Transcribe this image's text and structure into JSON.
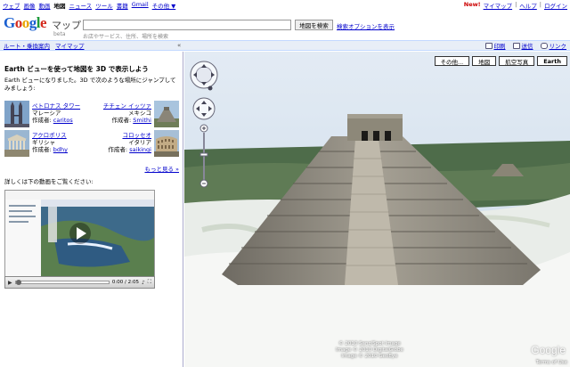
{
  "topnav": {
    "items": [
      {
        "label": "ウェブ",
        "current": false
      },
      {
        "label": "画像",
        "current": false
      },
      {
        "label": "動画",
        "current": false
      },
      {
        "label": "地図",
        "current": true
      },
      {
        "label": "ニュース",
        "current": false
      },
      {
        "label": "ツール",
        "current": false
      },
      {
        "label": "書籍",
        "current": false
      },
      {
        "label": "Gmail",
        "current": false
      },
      {
        "label": "その他 ▼",
        "current": false
      }
    ],
    "new_label": "New!",
    "mymaps": "マイマップ",
    "help": "ヘルプ",
    "login": "ログイン"
  },
  "header": {
    "product": "マップ",
    "beta": "beta",
    "search_value": "",
    "search_hint": "お店やサービス、住所、場所を検索",
    "search_button": "地図を検索",
    "search_options": "検索オプションを表示"
  },
  "toolbar": {
    "left_links": [
      "ルート・乗換案内",
      "マイマップ"
    ],
    "collapse": "«",
    "print": "印刷",
    "send": "送信",
    "link": "リンク"
  },
  "panel": {
    "title": "Earth ビューを使って地図を 3D で表示しよう",
    "description": "Earth ビューになりました。3D で次のような場所にジャンプしてみましょう:",
    "author_label": "作成者:",
    "places": [
      {
        "name": "ペトロナス タワー",
        "country": "マレーシア",
        "author": "caritos"
      },
      {
        "name": "チチェン イッツァ",
        "country": "メキシコ",
        "author": "Smithi"
      },
      {
        "name": "アクロポリス",
        "country": "ギリシャ",
        "author": "bdhy"
      },
      {
        "name": "コロッセオ",
        "country": "イタリア",
        "author": "saikingi"
      }
    ],
    "more": "もっと見る »",
    "video_caption": "詳しくは下の動画をご覧ください:",
    "video_time": "0:00 / 2:05"
  },
  "map": {
    "buttons": [
      {
        "label": "その他...",
        "active": false
      },
      {
        "label": "地図",
        "active": false
      },
      {
        "label": "航空写真",
        "active": false
      },
      {
        "label": "Earth",
        "active": true
      }
    ],
    "copyright": [
      "© 2010 Sanz/Spot Image",
      "Image © 2010 DigitalGlobe",
      "Image © 2010 GeoEye"
    ],
    "watermark": "Google",
    "terms": "Terms of Use"
  }
}
